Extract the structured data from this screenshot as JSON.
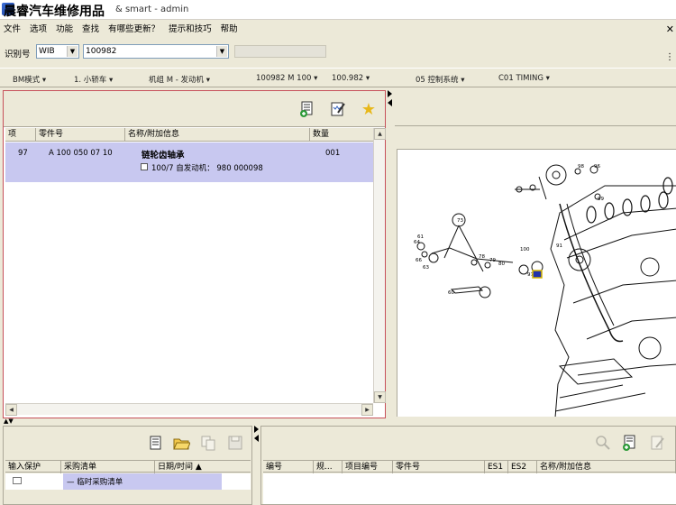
{
  "title": {
    "brand": "晨睿汽车维修用品",
    "suffix": "& smart - admin"
  },
  "menu": [
    "文件",
    "选项",
    "功能",
    "查找",
    "有哪些更新？",
    "提示和技巧",
    "帮助"
  ],
  "id_row": {
    "label": "识别号",
    "type_value": "WIB",
    "vin_value": "100982"
  },
  "classification": [
    "BM模式",
    "1. 小轿车",
    "机组 M - 发动机",
    "100982 M 100",
    "100.982",
    "05 控制系统",
    "C01 TIMING"
  ],
  "parts_table": {
    "headers": [
      "项",
      "零件号",
      "名称/附加信息",
      "数量"
    ],
    "rows": [
      {
        "item": "97",
        "part_no": "A 100 050 07 10",
        "name": "链轮齿轴承",
        "extra": "100/7 自发动机： 980 000098",
        "qty": "001"
      }
    ]
  },
  "bottom_left": {
    "headers": [
      "输入保护",
      "采购清单",
      "日期/时间"
    ],
    "sort_indicator": "▲",
    "row": {
      "list": "临时采购清单"
    }
  },
  "bottom_right": {
    "headers": [
      "编号",
      "规...",
      "项目编号",
      "零件号",
      "ES1",
      "ES2",
      "名称/附加信息"
    ]
  },
  "diagram_labels": [
    "73",
    "64",
    "66",
    "63",
    "78",
    "79",
    "80",
    "100",
    "91",
    "96",
    "98",
    "97",
    "99",
    "61",
    "60"
  ],
  "colors": {
    "selection": "#c8c8f0",
    "panel_border": "#c7505a",
    "chrome": "#ece9d8"
  }
}
